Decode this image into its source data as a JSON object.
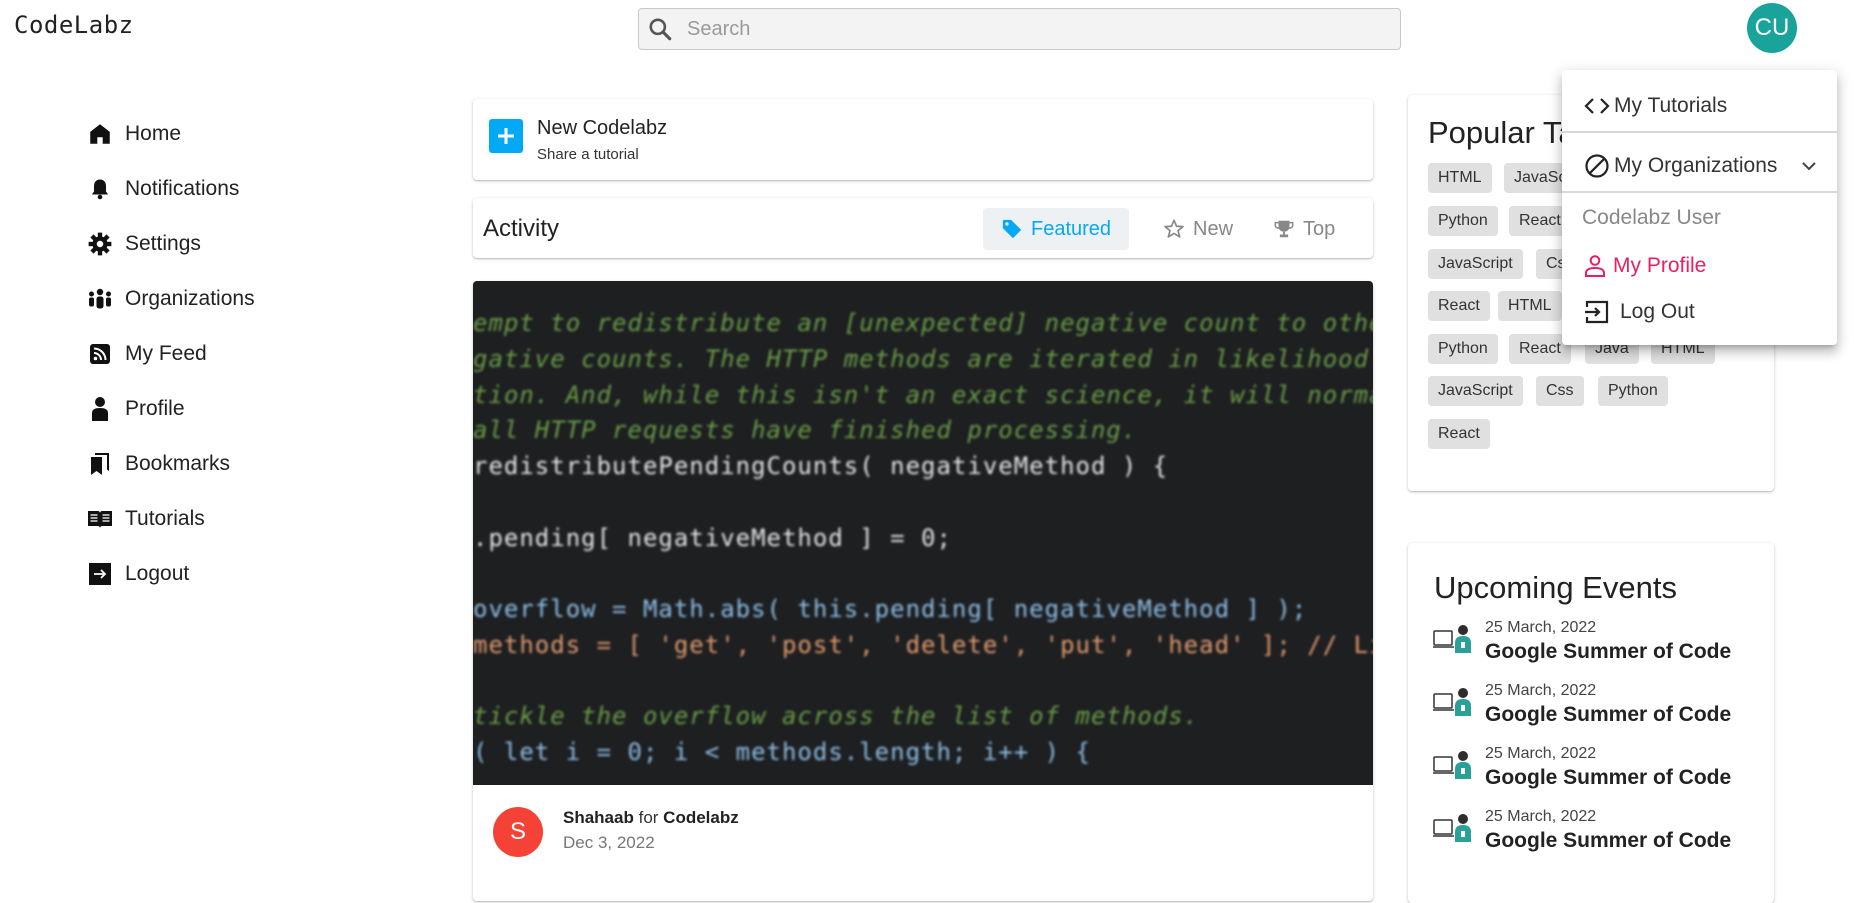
{
  "header": {
    "logo": "CodeLabz",
    "search_placeholder": "Search",
    "avatar_initials": "CU"
  },
  "sidebar": {
    "items": [
      {
        "label": "Home",
        "icon": "home-icon"
      },
      {
        "label": "Notifications",
        "icon": "bell-icon"
      },
      {
        "label": "Settings",
        "icon": "gear-icon"
      },
      {
        "label": "Organizations",
        "icon": "people-icon"
      },
      {
        "label": "My Feed",
        "icon": "rss-icon"
      },
      {
        "label": "Profile",
        "icon": "person-icon"
      },
      {
        "label": "Bookmarks",
        "icon": "bookmark-icon"
      },
      {
        "label": "Tutorials",
        "icon": "book-icon"
      },
      {
        "label": "Logout",
        "icon": "logout-icon"
      }
    ]
  },
  "new_card": {
    "title": "New Codelabz",
    "subtitle": "Share a tutorial"
  },
  "activity": {
    "title": "Activity",
    "tabs": [
      {
        "label": "Featured",
        "icon": "tag-icon",
        "active": true
      },
      {
        "label": "New",
        "icon": "star-icon",
        "active": false
      },
      {
        "label": "Top",
        "icon": "trophy-icon",
        "active": false
      }
    ]
  },
  "post": {
    "code_lines": [
      "empt to redistribute an [unexpected] negative count to other",
      "gative counts. The HTTP methods are iterated in likelihood of",
      "tion. And, while this isn't an exact science, it will normalize",
      " all HTTP requests have finished processing.",
      "redistributePendingCounts( negativeMethod ) {",
      "",
      ".pending[ negativeMethod ] = 0;",
      "",
      "overflow = Math.abs( this.pending[ negativeMethod ] );",
      "methods = [ 'get', 'post', 'delete', 'put', 'head' ]; // List",
      "",
      "tickle the overflow across the list of methods.",
      "( let i = 0; i < methods.length; i++ ) {"
    ],
    "author_initial": "S",
    "author": "Shahaab",
    "for_text": "for",
    "org": "Codelabz",
    "date": "Dec 3, 2022"
  },
  "popular_tags": {
    "title": "Popular Tags",
    "tags": [
      "HTML",
      "JavaScript",
      "Python",
      "React",
      "JavaScript",
      "Css",
      "React",
      "HTML",
      "Python",
      "React",
      "Java",
      "HTML",
      "JavaScript",
      "Css",
      "Python",
      "React"
    ]
  },
  "upcoming_events": {
    "title": "Upcoming Events",
    "events": [
      {
        "date": "25 March, 2022",
        "name": "Google Summer of Code"
      },
      {
        "date": "25 March, 2022",
        "name": "Google Summer of Code"
      },
      {
        "date": "25 March, 2022",
        "name": "Google Summer of Code"
      },
      {
        "date": "25 March, 2022",
        "name": "Google Summer of Code"
      }
    ]
  },
  "user_menu": {
    "my_tutorials": "My Tutorials",
    "my_organizations": "My Organizations",
    "user_name": "Codelabz User",
    "my_profile": "My Profile",
    "log_out": "Log Out"
  },
  "colors": {
    "accent": "#03a9f4",
    "avatar_bg": "#1aa39a",
    "author_avatar_bg": "#f44336",
    "profile_pink": "#e91e63"
  }
}
